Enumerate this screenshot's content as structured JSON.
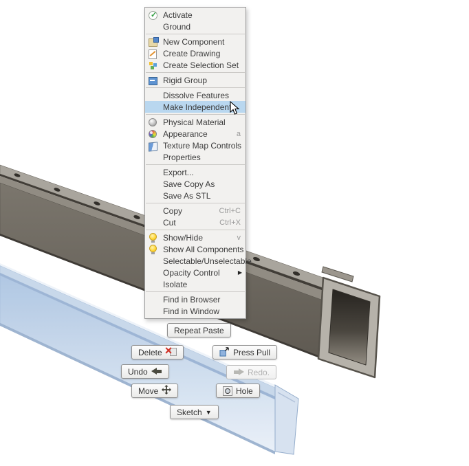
{
  "colors": {
    "highlight_row": "#b9d7ef",
    "menu_background": "#f2f1ef",
    "selected_body_blue": "#b9cfe8",
    "rail_body_gray": "#716c64"
  },
  "context_menu": {
    "items": [
      {
        "label": "Activate",
        "icon": "activate-icon"
      },
      {
        "label": "Ground"
      },
      {
        "label": "New Component",
        "icon": "new-component-icon"
      },
      {
        "label": "Create Drawing",
        "icon": "create-drawing-icon"
      },
      {
        "label": "Create Selection Set",
        "icon": "create-selection-set-icon"
      },
      {
        "label": "Rigid Group",
        "icon": "rigid-group-icon"
      },
      {
        "label": "Dissolve Features"
      },
      {
        "label": "Make Independent",
        "highlighted": true
      },
      {
        "label": "Physical Material",
        "icon": "physical-material-icon"
      },
      {
        "label": "Appearance",
        "icon": "appearance-icon",
        "shortcut": "a"
      },
      {
        "label": "Texture Map Controls",
        "icon": "texture-map-icon"
      },
      {
        "label": "Properties"
      },
      {
        "label": "Export..."
      },
      {
        "label": "Save Copy As"
      },
      {
        "label": "Save As STL"
      },
      {
        "label": "Copy",
        "shortcut": "Ctrl+C"
      },
      {
        "label": "Cut",
        "shortcut": "Ctrl+X"
      },
      {
        "label": "Show/Hide",
        "icon": "show-hide-icon",
        "shortcut": "v"
      },
      {
        "label": "Show All Components",
        "icon": "show-all-icon"
      },
      {
        "label": "Selectable/Unselectable"
      },
      {
        "label": "Opacity Control",
        "submenu": "▶"
      },
      {
        "label": "Isolate"
      },
      {
        "label": "Find in Browser"
      },
      {
        "label": "Find in Window"
      }
    ]
  },
  "marking_menu": {
    "repeat_paste": "Repeat Paste",
    "delete": "Delete",
    "press_pull": "Press Pull",
    "undo": "Undo",
    "redo": "Redo.",
    "move": "Move",
    "hole": "Hole",
    "sketch": "Sketch",
    "sketch_caret": "▼"
  },
  "icons": {
    "activate-icon": "green check in circle",
    "new-component-icon": "component board",
    "create-drawing-icon": "page with pencil",
    "create-selection-set-icon": "colored squares",
    "rigid-group-icon": "blue group box",
    "physical-material-icon": "gray sphere",
    "appearance-icon": "multicolor sphere",
    "texture-map-icon": "blue/white map cube",
    "show-hide-icon": "yellow lightbulb",
    "show-all-icon": "yellow lightbulb",
    "submenu-arrow-icon": "▶",
    "delete-icon": "red x over page",
    "press-pull-icon": "face with pull arrow",
    "undo-icon": "left arrow",
    "redo-icon": "right arrow",
    "move-icon": "four-way arrows",
    "hole-icon": "hole circle",
    "dropdown-icon": "▼"
  }
}
